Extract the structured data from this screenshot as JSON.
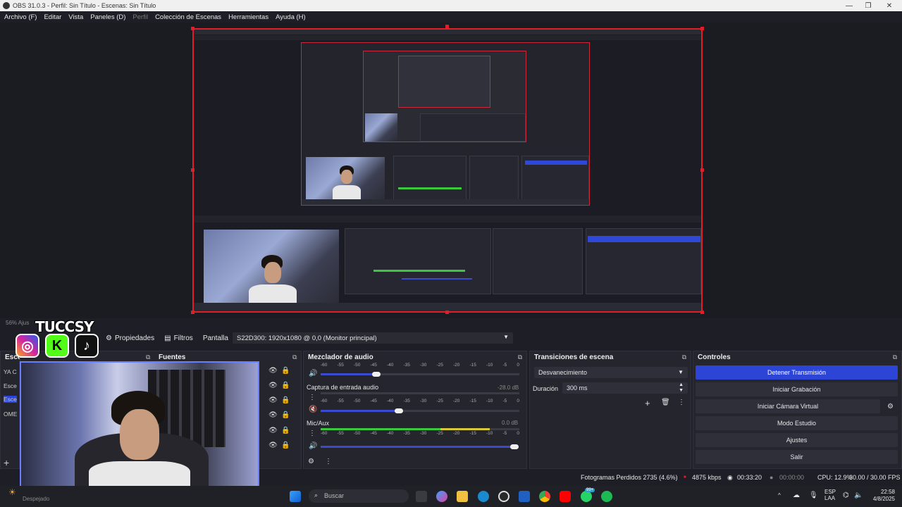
{
  "window": {
    "title": "OBS 31.0.3 - Perfil: Sin Título - Escenas: Sin Título",
    "minimize": "—",
    "maximize": "❐",
    "close": "✕"
  },
  "menu": {
    "archivo": "Archivo (F)",
    "editar": "Editar",
    "vista": "Vista",
    "paneles": "Paneles (D)",
    "perfil": "Perfil",
    "coleccion": "Colección de Escenas",
    "herramientas": "Herramientas",
    "ayuda": "Ayuda (H)"
  },
  "preview": {
    "zoom": "56%",
    "zoom_suffix": "Ajus"
  },
  "overlay": {
    "brand": "TUCCSY"
  },
  "toolbar": {
    "propiedades": "Propiedades",
    "filtros": "Filtros",
    "pantalla_label": "Pantalla",
    "pantalla_value": "S22D300: 1920x1080 @ 0,0 (Monitor principal)"
  },
  "docks": {
    "escenas": {
      "title": "Escenas",
      "items": [
        "YA C",
        "Esce",
        "Esce",
        "OME"
      ]
    },
    "fuentes": {
      "title": "Fuentes"
    },
    "mezclador": {
      "title": "Mezclador de audio",
      "scale": [
        "-60",
        "-55",
        "-50",
        "-45",
        "-40",
        "-35",
        "-30",
        "-25",
        "-20",
        "-15",
        "-10",
        "-5",
        "0"
      ],
      "channels": [
        {
          "name": "",
          "db": ""
        },
        {
          "name": "Captura de entrada audio",
          "db": "-28.0 dB"
        },
        {
          "name": "Mic/Aux",
          "db": "0.0 dB"
        }
      ]
    },
    "transiciones": {
      "title": "Transiciones de escena",
      "selected": "Desvanecimiento",
      "duracion_label": "Duración",
      "duracion_value": "300 ms"
    },
    "controles": {
      "title": "Controles",
      "buttons": [
        "Detener Transmisión",
        "Iniciar Grabación",
        "Iniciar Cámara Virtual",
        "Modo Estudio",
        "Ajustes",
        "Salir"
      ]
    }
  },
  "status": {
    "frames": "Fotogramas Perdidos 2735 (4.6%)",
    "kbps": "4875 kbps",
    "stream_time": "00:33:20",
    "rec_time": "00:00:00",
    "cpu": "CPU: 12.9%",
    "fps": "30.00 / 30.00 FPS"
  },
  "taskbar": {
    "weather": "Despejado",
    "search": "Buscar",
    "lang_top": "ESP",
    "lang_bottom": "LAA",
    "time": "22:58",
    "date": "4/8/2025",
    "badge": "99+"
  },
  "colors": {
    "accent": "#2c45d6",
    "selection": "#e01e2a",
    "meter_green": "#3cc83c",
    "meter_yellow": "#d8c83a"
  }
}
